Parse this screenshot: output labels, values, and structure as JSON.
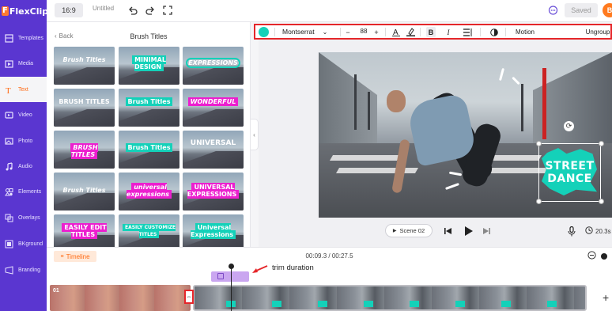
{
  "brand": {
    "logo": "FlexClip",
    "accent": "#5a36d0",
    "orange": "#ff6a14",
    "teal": "#14d1b9",
    "pink": "#ec1fcf"
  },
  "sidebar": {
    "items": [
      {
        "label": "Templates",
        "icon": "templates-icon"
      },
      {
        "label": "Media",
        "icon": "media-icon"
      },
      {
        "label": "Text",
        "icon": "text-icon",
        "active": true
      },
      {
        "label": "Video",
        "icon": "video-icon"
      },
      {
        "label": "Photo",
        "icon": "photo-icon"
      },
      {
        "label": "Audio",
        "icon": "audio-icon"
      },
      {
        "label": "Elements",
        "icon": "elements-icon"
      },
      {
        "label": "Overlays",
        "icon": "overlays-icon"
      },
      {
        "label": "BKground",
        "icon": "background-icon"
      },
      {
        "label": "Branding",
        "icon": "branding-icon"
      }
    ]
  },
  "topbar": {
    "ratio": "16:9",
    "title": "Untitled",
    "saved_label": "Saved",
    "avatar_initial": "B"
  },
  "panel": {
    "back_label": "Back",
    "title": "Brush Titles",
    "thumbs": [
      {
        "text": "Brush Titles",
        "style": "teal-italic"
      },
      {
        "text": "MINIMAL DESIGN",
        "style": "bg-teal"
      },
      {
        "text": "EXPRESSIONS",
        "style": "ring"
      },
      {
        "text": "BRUSH TITLES",
        "style": "plain"
      },
      {
        "text": "Brush Titles",
        "style": "bg-teal"
      },
      {
        "text": "WONDERFUL",
        "style": "bg-pink"
      },
      {
        "text": "BRUSH TITLES",
        "style": "bg-pink"
      },
      {
        "text": "Brush Titles",
        "style": "bg-teal"
      },
      {
        "text": "UNIVERSAL",
        "style": "plain"
      },
      {
        "text": "Brush Titles",
        "style": "teal-italic"
      },
      {
        "text": "universal expressions",
        "style": "bg-pink"
      },
      {
        "text": "UNIVERSAL EXPRESSIONS",
        "style": "bg-pink"
      },
      {
        "text": "EASILY EDIT TITLES",
        "style": "bg-pink"
      },
      {
        "text": "EASILY CUSTOMIZE TITLES",
        "style": "bg-teal"
      },
      {
        "text": "Universal Expressions",
        "style": "bg-teal"
      }
    ]
  },
  "text_toolbar": {
    "color": "#14d1b9",
    "font": "Montserrat",
    "size": "88",
    "motion_label": "Motion",
    "ungroup_label": "Ungroup"
  },
  "canvas": {
    "overlay_line1": "STREET",
    "overlay_line2": "DANCE"
  },
  "player": {
    "scene_label": "Scene 02",
    "duration_right": "20.3s"
  },
  "timeline": {
    "label": "Timeline",
    "time": "00:09.3 / 00:27.5",
    "clip1_number": "01",
    "annotation": "trim duration"
  }
}
